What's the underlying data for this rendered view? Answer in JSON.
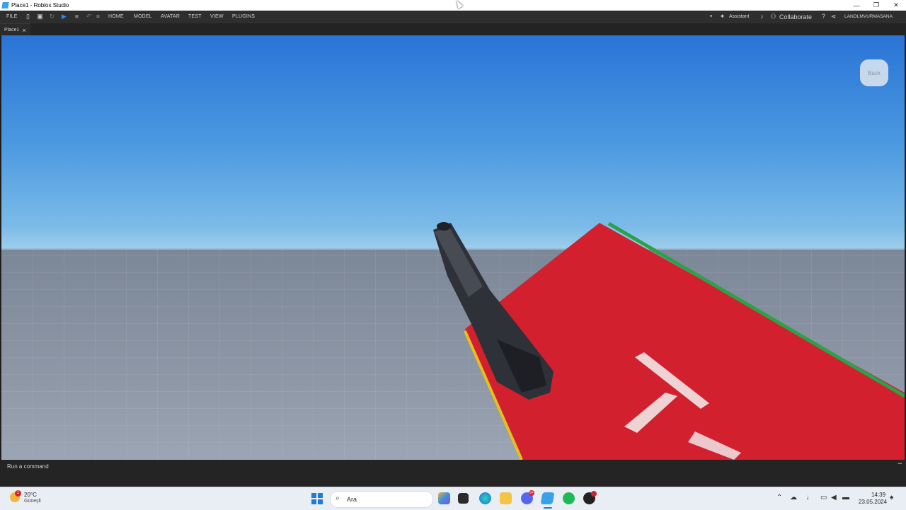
{
  "window": {
    "title": "Place1 - Roblox Studio",
    "controls": [
      "—",
      "❐",
      "✕"
    ]
  },
  "menubar": {
    "file": "FILE",
    "tabs": [
      "HOME",
      "MODEL",
      "AVATAR",
      "TEST",
      "VIEW",
      "PLUGINS"
    ],
    "assistant": "Assistant",
    "collaborate": "Collaborate",
    "username": "LANOLMVURMASANA"
  },
  "doc_tab": {
    "label": "Place1",
    "close": "×"
  },
  "viewport": {
    "back_label": "Back",
    "sky_colors": [
      "#2a74d6",
      "#9ccdeb"
    ],
    "part_color": "#d2202f",
    "part_edge_colors": [
      "#2ca14a",
      "#e2c21d"
    ]
  },
  "command_bar": {
    "placeholder": "Run a command"
  },
  "taskbar": {
    "weather_temp": "20°C",
    "weather_condition": "Güneşli",
    "weather_badge": "1",
    "search_placeholder": "Ara",
    "clock_time": "14:39",
    "clock_date": "23.05.2024",
    "badge_discord": "9+"
  }
}
